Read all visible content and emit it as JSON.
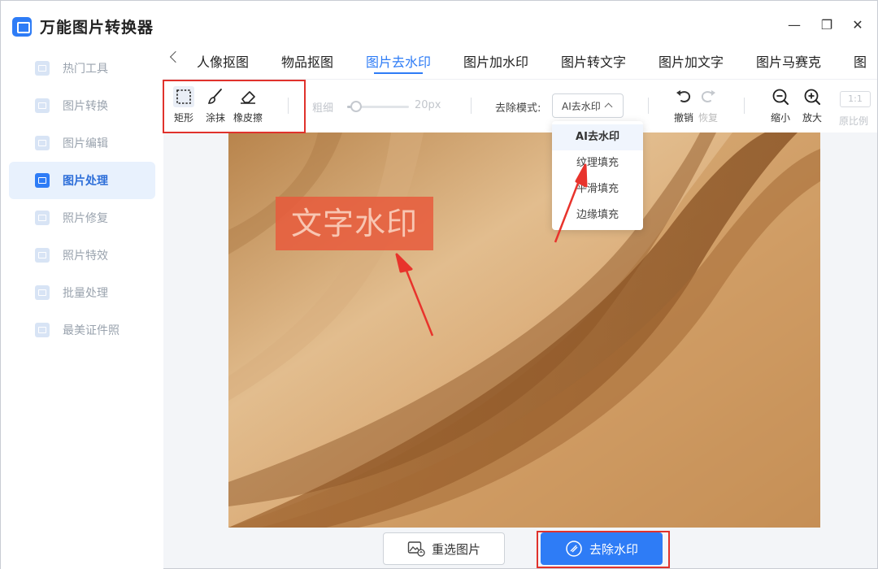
{
  "app": {
    "title": "万能图片转换器",
    "accent": "#2e7cf6"
  },
  "sidebar": {
    "items": [
      {
        "label": "热门工具",
        "icon": "hot-tools-icon"
      },
      {
        "label": "图片转换",
        "icon": "image-convert-icon"
      },
      {
        "label": "图片编辑",
        "icon": "image-edit-icon"
      },
      {
        "label": "图片处理",
        "icon": "image-process-icon",
        "active": true
      },
      {
        "label": "照片修复",
        "icon": "photo-repair-icon"
      },
      {
        "label": "照片特效",
        "icon": "photo-effects-icon"
      },
      {
        "label": "批量处理",
        "icon": "batch-process-icon"
      },
      {
        "label": "最美证件照",
        "icon": "id-photo-icon"
      }
    ]
  },
  "window": {
    "minimize": "—",
    "maximize": "❐",
    "close": "✕"
  },
  "tabs": [
    {
      "label": "人像抠图"
    },
    {
      "label": "物品抠图"
    },
    {
      "label": "图片去水印",
      "active": true
    },
    {
      "label": "图片加水印"
    },
    {
      "label": "图片转文字"
    },
    {
      "label": "图片加文字"
    },
    {
      "label": "图片马赛克"
    },
    {
      "label": "图"
    }
  ],
  "toolbar": {
    "rect_label": "矩形",
    "brush_label": "涂抹",
    "eraser_label": "橡皮擦",
    "thickness_label": "粗细",
    "thickness_value": "20px",
    "thickness_level": 0.15,
    "mode_label": "去除模式:",
    "mode_value": "AI去水印",
    "undo_label": "撤销",
    "redo_label": "恢复",
    "zoom_out_label": "缩小",
    "zoom_in_label": "放大",
    "ratio_button": "1:1",
    "ratio_label": "原比例"
  },
  "dropdown": {
    "options": [
      {
        "label": "AI去水印",
        "selected": true
      },
      {
        "label": "纹理填充"
      },
      {
        "label": "平滑填充"
      },
      {
        "label": "边缘填充"
      }
    ]
  },
  "canvas": {
    "watermark_text": "文字水印"
  },
  "bottom": {
    "reselect_label": "重选图片",
    "remove_label": "去除水印"
  }
}
